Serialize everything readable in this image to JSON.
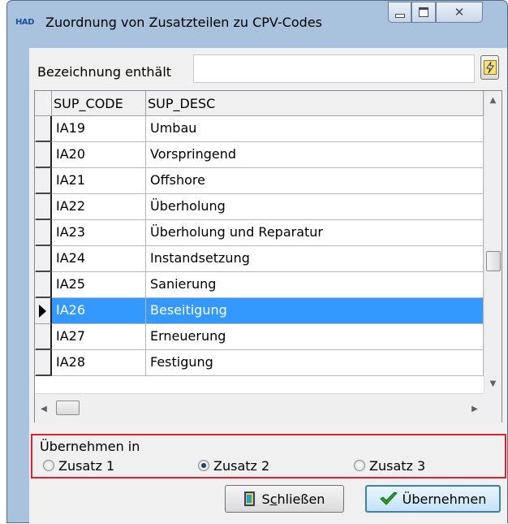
{
  "window": {
    "app_icon_text": "HAD",
    "title": "Zuordnung von Zusatzteilen zu CPV-Codes",
    "close_glyph": "✕"
  },
  "filter": {
    "label": "Bezeichnung enthält",
    "value": "",
    "placeholder": ""
  },
  "grid": {
    "columns": [
      "SUP_CODE",
      "SUP_DESC"
    ],
    "rows": [
      {
        "code": "IA19",
        "desc": "Umbau"
      },
      {
        "code": "IA20",
        "desc": "Vorspringend"
      },
      {
        "code": "IA21",
        "desc": "Offshore"
      },
      {
        "code": "IA22",
        "desc": "Überholung"
      },
      {
        "code": "IA23",
        "desc": "Überholung und Reparatur"
      },
      {
        "code": "IA24",
        "desc": "Instandsetzung"
      },
      {
        "code": "IA25",
        "desc": "Sanierung"
      },
      {
        "code": "IA26",
        "desc": "Beseitigung"
      },
      {
        "code": "IA27",
        "desc": "Erneuerung"
      },
      {
        "code": "IA28",
        "desc": "Festigung"
      }
    ],
    "selected_index": 7,
    "vertical_scroll_fraction": 0.58,
    "horizontal_scroll_fraction": 0.0
  },
  "apply_to": {
    "title": "Übernehmen in",
    "options": [
      {
        "label": "Zusatz 1",
        "checked": false
      },
      {
        "label": "Zusatz 2",
        "checked": true
      },
      {
        "label": "Zusatz 3",
        "checked": false
      }
    ],
    "outline_color": "#e0202a"
  },
  "buttons": {
    "close_mnemonic": "c",
    "close_prefix": "S",
    "close_suffix": "hließen",
    "apply_label": "Übernehmen"
  },
  "colors": {
    "selection": "#3399ff",
    "window_frame": "#a9c3de",
    "client": "#f0f0f0"
  }
}
